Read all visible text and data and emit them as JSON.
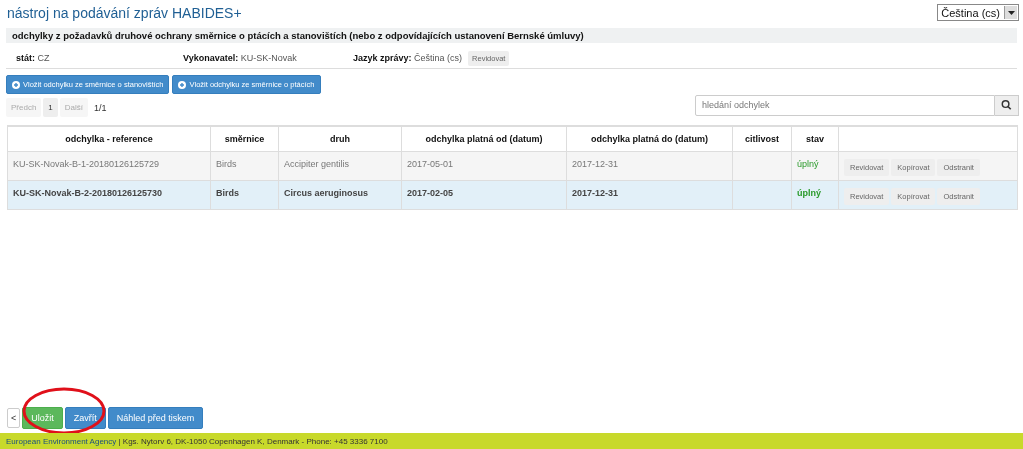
{
  "app_title": "nástroj na podávání zpráv HABIDES+",
  "language_select": {
    "value": "Čeština (cs)"
  },
  "section_title": "odchylky z požadavků druhové ochrany směrnice o ptácích a stanovištích (nebo z odpovídajících ustanovení Bernské úmluvy)",
  "info": [
    {
      "label": "stát:",
      "value": "CZ"
    },
    {
      "label": "Vykonavatel:",
      "value": "KU-SK-Novak"
    },
    {
      "label": "Jazyk zprávy:",
      "value": "Čeština (cs)",
      "button": "Revidovat"
    }
  ],
  "add_buttons": [
    "Vložit odchylku ze směrnice o stanovištích",
    "Vložit odchylku ze směrnice o ptácích"
  ],
  "pager": {
    "prev": "Předch",
    "page": "1",
    "next": "Další",
    "count": "1/1"
  },
  "search": {
    "placeholder": "hledání odchylek"
  },
  "table": {
    "columns": [
      "odchylka - reference",
      "směrnice",
      "druh",
      "odchylka platná od (datum)",
      "odchylka platná do (datum)",
      "citlivost",
      "stav"
    ],
    "rows": [
      {
        "selected": false,
        "cells": [
          "KU-SK-Novak-B-1-20180126125729",
          "Birds",
          "Accipiter gentilis",
          "2017-05-01",
          "2017-12-31",
          ""
        ],
        "status": "úplný",
        "actions": [
          "Revidovat",
          "Kopírovat",
          "Odstranit"
        ]
      },
      {
        "selected": true,
        "cells": [
          "KU-SK-Novak-B-2-20180126125730",
          "Birds",
          "Circus aeruginosus",
          "2017-02-05",
          "2017-12-31",
          ""
        ],
        "status": "úplný",
        "actions": [
          "Revidovat",
          "Kopírovat",
          "Odstranit"
        ]
      }
    ]
  },
  "bottom_buttons": [
    {
      "kind": "back",
      "label": "<"
    },
    {
      "kind": "success",
      "label": "Uložit"
    },
    {
      "kind": "primary",
      "label": "Zavřít"
    },
    {
      "kind": "primary",
      "label": "Náhled před tiskem"
    }
  ],
  "annotation": {
    "kind": "ellipse",
    "color": "#e0101a"
  },
  "footer": {
    "link": "European Environment Agency",
    "text": "| Kgs. Nytorv 6, DK-1050 Copenhagen K, Denmark - Phone: +45 3336 7100"
  }
}
